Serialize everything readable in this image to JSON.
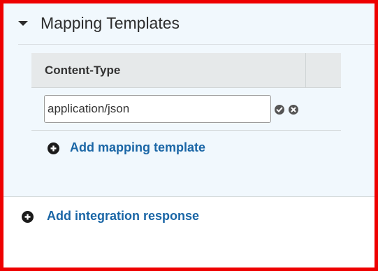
{
  "mapping_templates": {
    "title": "Mapping Templates",
    "table": {
      "column_header": "Content-Type",
      "rows": [
        {
          "content_type": "application/json"
        }
      ]
    },
    "add_template_label": "Add mapping template"
  },
  "add_integration_response_label": "Add integration response",
  "icons": {
    "collapse": "caret-down-icon",
    "confirm": "check-circle-icon",
    "cancel": "x-circle-icon",
    "add": "plus-circle-icon"
  },
  "colors": {
    "section_bg": "#f1f8fd",
    "link": "#1a66a6",
    "frame": "#ee0000",
    "header_bg": "#e6e9ea"
  }
}
